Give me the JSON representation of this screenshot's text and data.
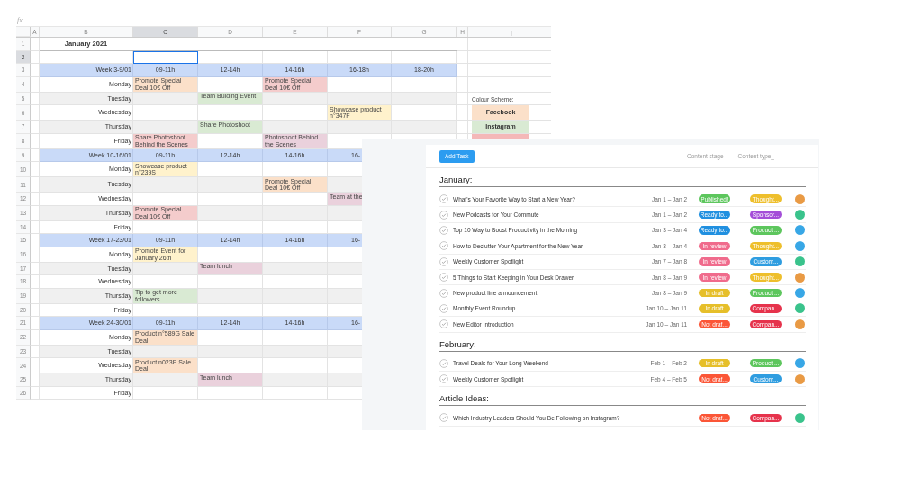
{
  "spreadsheet": {
    "formula_label": "fx",
    "columns": [
      {
        "label": "A",
        "selected": false
      },
      {
        "label": "B",
        "selected": false
      },
      {
        "label": "C",
        "selected": true
      },
      {
        "label": "D",
        "selected": false
      },
      {
        "label": "E",
        "selected": false
      },
      {
        "label": "F",
        "selected": false
      },
      {
        "label": "G",
        "selected": false
      },
      {
        "label": "H",
        "selected": false
      },
      {
        "label": "I",
        "selected": false
      }
    ],
    "row_numbers": [
      {
        "label": "1",
        "selected": false
      },
      {
        "label": "2",
        "selected": true
      },
      {
        "label": "3",
        "selected": false
      },
      {
        "label": "4",
        "selected": false
      },
      {
        "label": "5",
        "selected": false
      },
      {
        "label": "6",
        "selected": false
      },
      {
        "label": "7",
        "selected": false
      },
      {
        "label": "8",
        "selected": false
      },
      {
        "label": "9",
        "selected": false
      },
      {
        "label": "10",
        "selected": false
      },
      {
        "label": "11",
        "selected": false
      },
      {
        "label": "12",
        "selected": false
      },
      {
        "label": "13",
        "selected": false
      },
      {
        "label": "14",
        "selected": false
      },
      {
        "label": "15",
        "selected": false
      },
      {
        "label": "16",
        "selected": false
      },
      {
        "label": "17",
        "selected": false
      },
      {
        "label": "18",
        "selected": false
      },
      {
        "label": "19",
        "selected": false
      },
      {
        "label": "20",
        "selected": false
      },
      {
        "label": "21",
        "selected": false
      },
      {
        "label": "22",
        "selected": false
      },
      {
        "label": "23",
        "selected": false
      },
      {
        "label": "24",
        "selected": false
      },
      {
        "label": "25",
        "selected": false
      },
      {
        "label": "26",
        "selected": false
      }
    ],
    "title": "January 2021",
    "weeks": [
      {
        "label": "Week 3-9/01",
        "slots": [
          "09-11h",
          "12-14h",
          "14-16h",
          "16-18h",
          "18-20h"
        ],
        "days": [
          {
            "name": "Monday",
            "cells": [
              {
                "text": "Promote Special Deal 10€ Off",
                "color": "#fbe0c9"
              },
              null,
              {
                "text": "Promote Special Deal 10€ Off",
                "color": "#f4cccc"
              },
              null,
              null
            ]
          },
          {
            "name": "Tuesday",
            "cells": [
              null,
              {
                "text": "Team Bulding Event",
                "color": "#d9ead3"
              },
              null,
              null,
              null
            ]
          },
          {
            "name": "Wednesday",
            "cells": [
              null,
              null,
              null,
              {
                "text": "Showcase product n°347F",
                "color": "#fff2cc"
              },
              null
            ]
          },
          {
            "name": "Thursday",
            "cells": [
              null,
              {
                "text": "Share Photoshoot",
                "color": "#d9ead3"
              },
              null,
              null,
              null
            ]
          },
          {
            "name": "Friday",
            "cells": [
              {
                "text": "Share Photoshoot Behind the Scenes",
                "color": "#f4cccc"
              },
              null,
              {
                "text": "Photoshoot Behind the Scenes",
                "color": "#ead1dc"
              },
              null,
              null
            ]
          }
        ]
      },
      {
        "label": "Week 10-16/01",
        "slots": [
          "09-11h",
          "12-14h",
          "14-16h",
          "16-"
        ],
        "days": [
          {
            "name": "Monday",
            "cells": [
              {
                "text": "Showcase product n°239S",
                "color": "#fff2cc"
              },
              null,
              null,
              null
            ]
          },
          {
            "name": "Tuesday",
            "cells": [
              null,
              null,
              {
                "text": "Promote Special Deal 10€ Off",
                "color": "#fbe0c9"
              },
              null
            ]
          },
          {
            "name": "Wednesday",
            "cells": [
              null,
              null,
              null,
              {
                "text": "Team at the",
                "color": "#ead1dc"
              }
            ]
          },
          {
            "name": "Thursday",
            "cells": [
              {
                "text": "Promote Special Deal 10€ Off",
                "color": "#f4cccc"
              },
              null,
              null,
              null
            ]
          },
          {
            "name": "Friday",
            "cells": [
              null,
              null,
              null,
              null
            ]
          }
        ]
      },
      {
        "label": "Week 17-23/01",
        "slots": [
          "09-11h",
          "12-14h",
          "14-16h",
          "16-"
        ],
        "days": [
          {
            "name": "Monday",
            "cells": [
              {
                "text": "Promote Event for January 26th",
                "color": "#fff2cc"
              },
              null,
              null,
              null
            ]
          },
          {
            "name": "Tuesday",
            "cells": [
              null,
              {
                "text": "Team lunch",
                "color": "#ead1dc"
              },
              null,
              null
            ]
          },
          {
            "name": "Wednesday",
            "cells": [
              null,
              null,
              null,
              null
            ]
          },
          {
            "name": "Thursday",
            "cells": [
              {
                "text": "Tip to get more followers",
                "color": "#d9ead3"
              },
              null,
              null,
              null
            ]
          },
          {
            "name": "Friday",
            "cells": [
              null,
              null,
              null,
              null
            ]
          }
        ]
      },
      {
        "label": "Week 24-30/01",
        "slots": [
          "09-11h",
          "12-14h",
          "14-16h",
          "16-"
        ],
        "days": [
          {
            "name": "Monday",
            "cells": [
              {
                "text": "Product n°589G Sale Deal",
                "color": "#fbe0c9"
              },
              null,
              null,
              null
            ]
          },
          {
            "name": "Tuesday",
            "cells": [
              null,
              null,
              null,
              null
            ]
          },
          {
            "name": "Wednesday",
            "cells": [
              {
                "text": "Product n023P Sale Deal",
                "color": "#fbe0c9"
              },
              null,
              null,
              null
            ]
          },
          {
            "name": "Thursday",
            "cells": [
              null,
              {
                "text": "Team lunch",
                "color": "#ead1dc"
              },
              null,
              null
            ]
          },
          {
            "name": "Friday",
            "cells": [
              null,
              null,
              null,
              null
            ]
          }
        ]
      }
    ],
    "legend": {
      "title": "Colour Scheme:",
      "entries": [
        {
          "label": "Facebook",
          "color": "#fbe0c9"
        },
        {
          "label": "Instagram",
          "color": "#d9ead3"
        },
        {
          "color": "#f4b8b8"
        }
      ]
    }
  },
  "task_panel": {
    "add_button": "Add Task",
    "column_headers": [
      "Content stage",
      "Content type_"
    ],
    "sections": [
      {
        "title": "January:",
        "tasks": [
          {
            "title": "What's Your Favorite Way to Start a New Year?",
            "dates": "Jan 1 – Jan 2",
            "done": false,
            "stage": {
              "label": "Published!",
              "color": "#5dc65d"
            },
            "type": {
              "label": "Thought...",
              "color": "#eebf2c"
            },
            "avatar": {
              "color": "#e99a44"
            }
          },
          {
            "title": "New Podcasts for Your Commute",
            "dates": "Jan 1 – Jan 2",
            "done": false,
            "stage": {
              "label": "Ready to...",
              "color": "#2190e0"
            },
            "type": {
              "label": "Sponsor...",
              "color": "#a44ed8"
            },
            "avatar": {
              "color": "#3ac38c"
            }
          },
          {
            "title": "Top 10 Way to Boost Productivity in the Morning",
            "dates": "Jan 3 – Jan 4",
            "done": false,
            "stage": {
              "label": "Ready to...",
              "color": "#2190e0"
            },
            "type": {
              "label": "Product ...",
              "color": "#5dc65d"
            },
            "avatar": {
              "color": "#38a7e6"
            }
          },
          {
            "title": "How to Declutter Your Apartment for the New Year",
            "dates": "Jan 3 – Jan 4",
            "done": false,
            "stage": {
              "label": "In review",
              "color": "#f06b8c"
            },
            "type": {
              "label": "Thought...",
              "color": "#eebf2c"
            },
            "avatar": {
              "color": "#38a7e6"
            }
          },
          {
            "title": "Weekly Customer Spotlight",
            "dates": "Jan 7 – Jan 8",
            "done": false,
            "stage": {
              "label": "In review",
              "color": "#f06b8c"
            },
            "type": {
              "label": "Custom...",
              "color": "#2f9de0"
            },
            "avatar": {
              "color": "#3ac38c"
            }
          },
          {
            "title": "5 Things to Start Keeping in Your Desk Drawer",
            "dates": "Jan 8 – Jan 9",
            "done": false,
            "stage": {
              "label": "In review",
              "color": "#f06b8c"
            },
            "type": {
              "label": "Thought...",
              "color": "#eebf2c"
            },
            "avatar": {
              "color": "#e99a44"
            }
          },
          {
            "title": "New product line announcement",
            "dates": "Jan 8 – Jan 9",
            "done": false,
            "stage": {
              "label": "In draft",
              "color": "#e6bf2a"
            },
            "type": {
              "label": "Product ...",
              "color": "#5dc65d"
            },
            "avatar": {
              "color": "#38a7e6"
            }
          },
          {
            "title": "Monthly Event Roundup",
            "dates": "Jan 10 – Jan 11",
            "done": false,
            "stage": {
              "label": "In draft",
              "color": "#e6bf2a"
            },
            "type": {
              "label": "Compan...",
              "color": "#e6334c"
            },
            "avatar": {
              "color": "#3ac38c"
            }
          },
          {
            "title": "New Editor Introduction",
            "dates": "Jan 10 – Jan 11",
            "done": false,
            "stage": {
              "label": "Not draf...",
              "color": "#fb5637"
            },
            "type": {
              "label": "Compan...",
              "color": "#e6334c"
            },
            "avatar": {
              "color": "#e99a44"
            }
          }
        ]
      },
      {
        "title": "February:",
        "tasks": [
          {
            "title": "Travel Deals for Your Long Weekend",
            "dates": "Feb 1 – Feb 2",
            "done": false,
            "stage": {
              "label": "In draft",
              "color": "#e6bf2a"
            },
            "type": {
              "label": "Product ...",
              "color": "#5dc65d"
            },
            "avatar": {
              "color": "#38a7e6"
            }
          },
          {
            "title": "Weekly Customer Spotlight",
            "dates": "Feb 4 – Feb 5",
            "done": false,
            "stage": {
              "label": "Not draf...",
              "color": "#fb5637"
            },
            "type": {
              "label": "Custom...",
              "color": "#2f9de0"
            },
            "avatar": {
              "color": "#e99a44"
            }
          }
        ]
      },
      {
        "title": "Article Ideas:",
        "tasks": [
          {
            "title": "Which Industry Leaders Should You Be Following on Instagram?",
            "done": false,
            "stage": {
              "label": "Not draf...",
              "color": "#fb5637"
            },
            "type": {
              "label": "Compan...",
              "color": "#e6334c"
            },
            "avatar": {
              "color": "#3ac38c"
            }
          }
        ]
      }
    ]
  }
}
